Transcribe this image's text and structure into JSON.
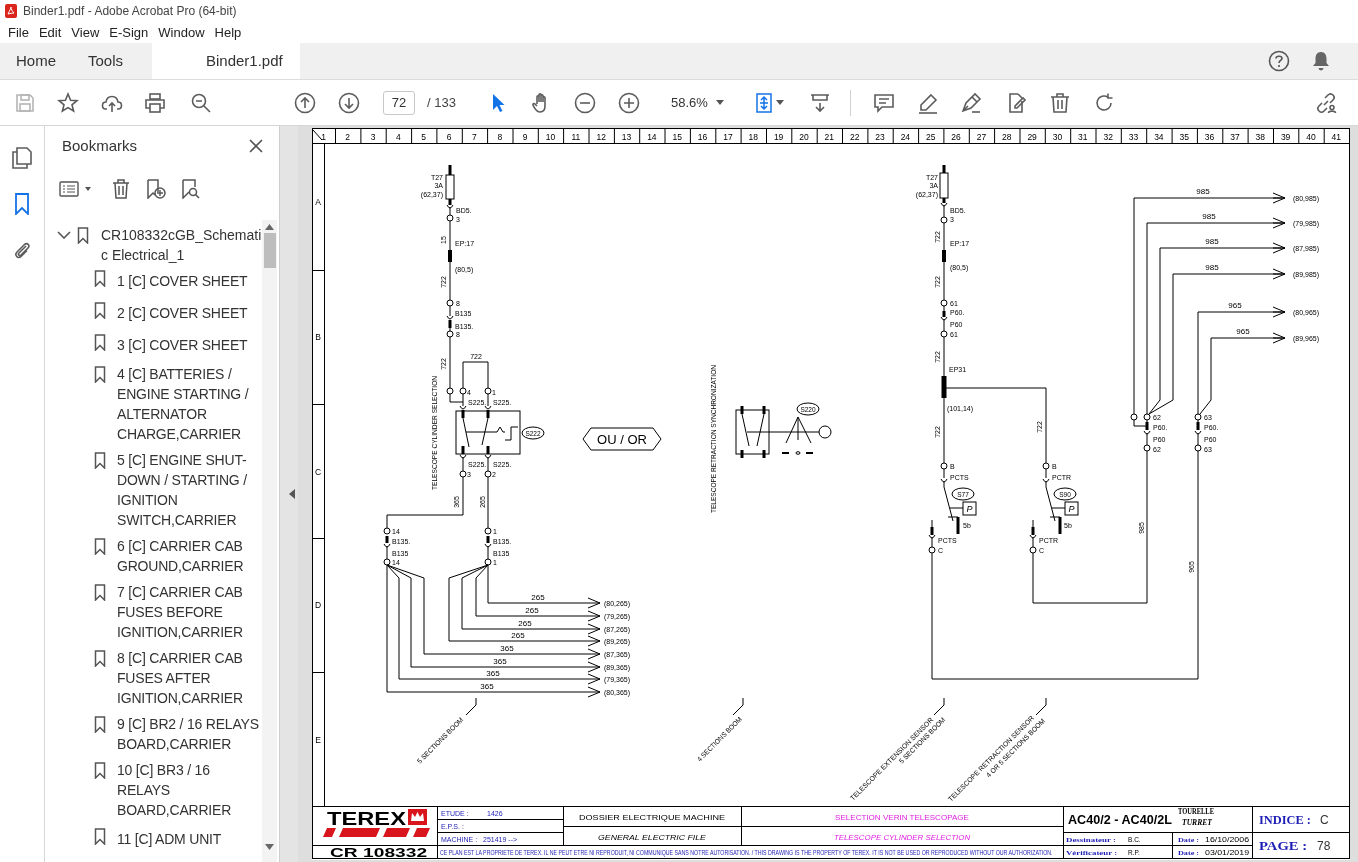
{
  "window": {
    "title": "Binder1.pdf - Adobe Acrobat Pro (64-bit)"
  },
  "menu": [
    "File",
    "Edit",
    "View",
    "E-Sign",
    "Window",
    "Help"
  ],
  "tabs": [
    {
      "label": "Home",
      "selected": false
    },
    {
      "label": "Tools",
      "selected": false
    },
    {
      "label": "Binder1.pdf",
      "selected": true
    }
  ],
  "toolbar": {
    "page": "72",
    "page_count": "/ 133",
    "zoom": "58.6%"
  },
  "side_rail": [
    {
      "kind": "pages",
      "selected": false
    },
    {
      "kind": "bookmarks",
      "selected": true
    },
    {
      "kind": "attachments",
      "selected": false
    }
  ],
  "bookmarks": {
    "title": "Bookmarks",
    "tree": [
      {
        "label": "CR108332cGB_Schematic Electrical_1",
        "expanded": true,
        "children": [
          {
            "label": "1 [C] COVER SHEET"
          },
          {
            "label": "2 [C] COVER SHEET"
          },
          {
            "label": "3 [C] COVER SHEET"
          },
          {
            "label": "4 [C] BATTERIES / ENGINE STARTING / ALTERNATOR CHARGE,CARRIER"
          },
          {
            "label": "5 [C] ENGINE SHUT-DOWN / STARTING / IGNITION SWITCH,CARRIER"
          },
          {
            "label": "6 [C] CARRIER CAB GROUND,CARRIER"
          },
          {
            "label": "7 [C] CARRIER CAB FUSES BEFORE IGNITION,CARRIER"
          },
          {
            "label": "8 [C] CARRIER CAB FUSES AFTER IGNITION,CARRIER"
          },
          {
            "label": "9 [C] BR2 / 16 RELAYS BOARD,CARRIER"
          },
          {
            "label": "10 [C] BR3 / 16 RELAYS BOARD,CARRIER"
          },
          {
            "label": "11 [C] ADM UNIT"
          }
        ]
      }
    ]
  },
  "schematic": {
    "column_numbers": [
      "1",
      "2",
      "3",
      "4",
      "5",
      "6",
      "7",
      "8",
      "9",
      "10",
      "11",
      "12",
      "13",
      "14",
      "15",
      "16",
      "17",
      "18",
      "19",
      "20",
      "21",
      "22",
      "23",
      "24",
      "25",
      "26",
      "27",
      "28",
      "29",
      "30",
      "31",
      "32",
      "33",
      "34",
      "35",
      "36",
      "37",
      "38",
      "39",
      "40",
      "41"
    ],
    "row_letters": [
      "A",
      "B",
      "C",
      "D",
      "E"
    ],
    "left_circuit": {
      "labels": [
        "T27",
        "3A",
        "(62,37)",
        "BD5.",
        "3",
        "15",
        "EP:17",
        "(80,5)",
        "722",
        "8",
        "B135",
        "B135.",
        "8",
        "722",
        "722",
        "4",
        "1",
        "S225.",
        "S225.",
        "S222",
        "S225.",
        "S225.",
        "3",
        "2",
        "TELESCOPE CYLINDER SELECTION",
        "365",
        "265",
        "14",
        "B135.",
        "B135",
        "14",
        "1",
        "B135.",
        "B135",
        "1"
      ],
      "destinations": [
        {
          "wire": "265",
          "ref": "(80,265)"
        },
        {
          "wire": "265",
          "ref": "(79,265)"
        },
        {
          "wire": "265",
          "ref": "(87,265)"
        },
        {
          "wire": "265",
          "ref": "(89,265)"
        },
        {
          "wire": "365",
          "ref": "(87,365)"
        },
        {
          "wire": "365",
          "ref": "(89,365)"
        },
        {
          "wire": "365",
          "ref": "(79,365)"
        },
        {
          "wire": "365",
          "ref": "(80,365)"
        }
      ],
      "note": "5 SECTIONS BOOM"
    },
    "or_marker": "OU / OR",
    "synchronization_switch": {
      "label": "TELESCOPE RETRACTION SYNCHRONIZATION",
      "tag": "S220",
      "note": "4 SECTIONS BOOM"
    },
    "right_circuit": {
      "labels": [
        "T27",
        "3A",
        "(62,37)",
        "BD5.",
        "3",
        "722",
        "EP:17",
        "(80,5)",
        "722",
        "61",
        "P60.",
        "P60",
        "61",
        "722",
        "EP31",
        "(101,14)",
        "722",
        "722",
        "B",
        "PCTS",
        "S77",
        "B",
        "PCTR",
        "S90",
        "P",
        "P",
        "5b",
        "5b",
        "PCTS",
        "C",
        "PCTR",
        "C",
        "62",
        "P60.",
        "P60",
        "62",
        "63",
        "P60.",
        "P60",
        "63",
        "985",
        "965"
      ],
      "destinations": [
        {
          "wire": "985",
          "ref": "(80,985)"
        },
        {
          "wire": "985",
          "ref": "(79,985)"
        },
        {
          "wire": "985",
          "ref": "(87,985)"
        },
        {
          "wire": "985",
          "ref": "(89,985)"
        },
        {
          "wire": "965",
          "ref": "(80,965)"
        },
        {
          "wire": "965",
          "ref": "(89,965)"
        }
      ],
      "notes": [
        "TELESCOPE EXTENSION SENSOR",
        "5 SECTIONS BOOM",
        "TELESCOPE RETRACTION SENSOR",
        "4 OR 5 SECTIONS BOOM"
      ]
    },
    "title_block": {
      "logo": "TEREX",
      "drawing_number": "CR 108332",
      "etude_label": "ETUDE :",
      "etude": "1426",
      "eps_label": "E.P.S. :",
      "machine_label": "MACHINE :",
      "machine": "251419 -->",
      "file_fr": "DOSSIER ELECTRIQUE MACHINE",
      "file_en": "GENERAL ELECTRIC FILE",
      "title_fr": "SELECTION VERIN TELESCOPAGE",
      "title_en": "TELESCOPE CYLINDER SELECTION",
      "model": "AC40/2 - AC40/2L",
      "section_fr": "TOURELLE",
      "section_en": "TURRET",
      "drawn_by_label": "Dessinateur :",
      "drawn_by": "B.C.",
      "date_label": "Date :",
      "date_drawn": "16/10/2006",
      "checked_by_label": "Vérificateur :",
      "checked_by": "R.P.",
      "date_label_2": "Date :",
      "date_checked": "03/01/2019",
      "index_label": "INDICE :",
      "index": "C",
      "page_label": "PAGE :",
      "page": "78",
      "disclaimer": "CE PLAN EST LA PROPRIETE DE TEREX. IL NE PEUT ETRE NI REPRODUIT, NI COMMUNIQUE SANS NOTRE AUTORISATION. / THIS DRAWING IS THE PROPERTY OF TEREX. IT IS NOT BE USED OR REPRODUCED WITHOUT OUR AUTHORIZATION."
    }
  }
}
